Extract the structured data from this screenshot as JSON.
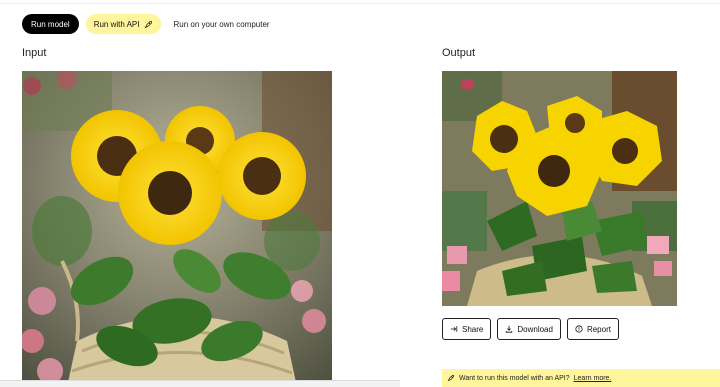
{
  "tabs": {
    "run_model": "Run model",
    "run_with_api": "Run with API",
    "run_local": "Run on your own computer"
  },
  "input": {
    "title": "Input"
  },
  "output": {
    "title": "Output"
  },
  "actions": {
    "share": "Share",
    "download": "Download",
    "report": "Report"
  },
  "api_banner": {
    "text": "Want to run this model with an API?",
    "link": "Learn more."
  },
  "icons": {
    "api": "rocket-icon",
    "share": "share-arrow-icon",
    "download": "download-icon",
    "report": "report-icon",
    "banner": "rocket-icon"
  },
  "colors": {
    "accent_yellow": "#fff59c",
    "primary_black": "#000000"
  }
}
